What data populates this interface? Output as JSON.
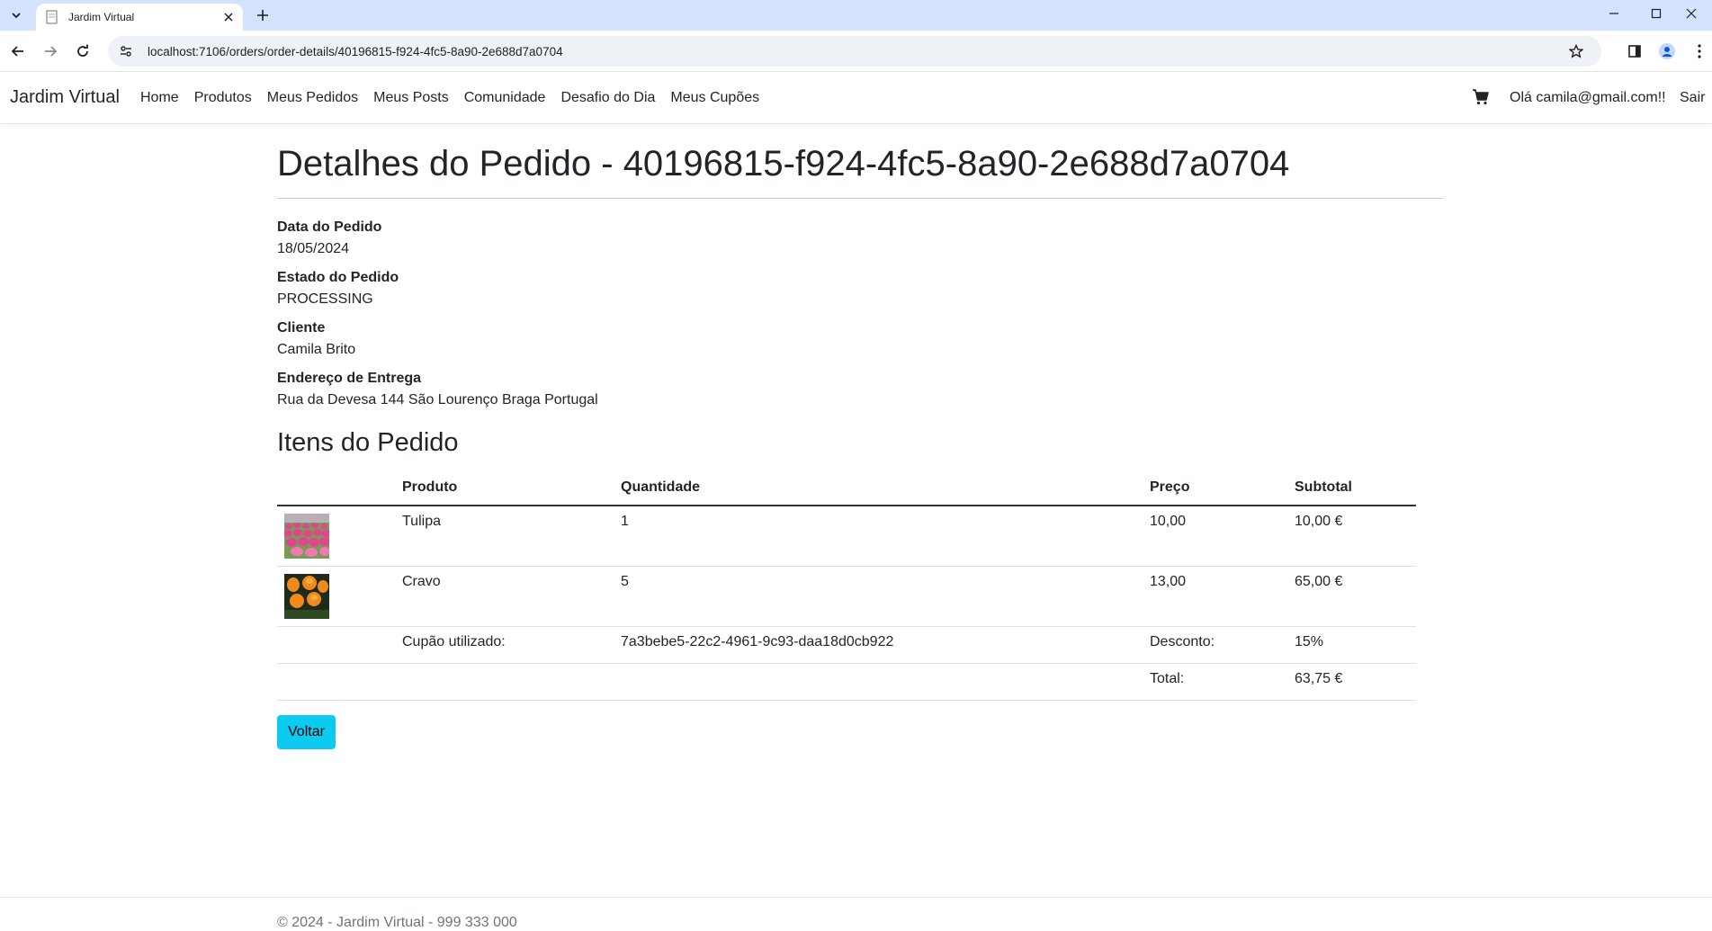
{
  "browser": {
    "tab_title": "Jardim Virtual",
    "url": "localhost:7106/orders/order-details/40196815-f924-4fc5-8a90-2e688d7a0704"
  },
  "navbar": {
    "brand": "Jardim Virtual",
    "links": [
      "Home",
      "Produtos",
      "Meus Pedidos",
      "Meus Posts",
      "Comunidade",
      "Desafio do Dia",
      "Meus Cupões"
    ],
    "greeting": "Olá camila@gmail.com!!",
    "logout": "Sair"
  },
  "order": {
    "title": "Detalhes do Pedido - 40196815-f924-4fc5-8a90-2e688d7a0704",
    "date_label": "Data do Pedido",
    "date": "18/05/2024",
    "status_label": "Estado do Pedido",
    "status": "PROCESSING",
    "client_label": "Cliente",
    "client": "Camila Brito",
    "address_label": "Endereço de Entrega",
    "address": "Rua da Devesa 144 São Lourenço Braga Portugal"
  },
  "items": {
    "title": "Itens do Pedido",
    "headers": [
      "",
      "Produto",
      "Quantidade",
      "Preço",
      "Subtotal"
    ],
    "rows": [
      {
        "product": "Tulipa",
        "quantity": "1",
        "price": "10,00",
        "subtotal": "10,00 €"
      },
      {
        "product": "Cravo",
        "quantity": "5",
        "price": "13,00",
        "subtotal": "65,00 €"
      }
    ],
    "coupon_label": "Cupão utilizado:",
    "coupon_code": "7a3bebe5-22c2-4961-9c93-daa18d0cb922",
    "discount_label": "Desconto:",
    "discount": "15%",
    "total_label": "Total:",
    "total": "63,75 €"
  },
  "back_button": "Voltar",
  "footer": "© 2024 - Jardim Virtual - 999 333 000",
  "colors": {
    "tabstrip": "#d3e3fd",
    "button_info": "#0dcaf0"
  }
}
